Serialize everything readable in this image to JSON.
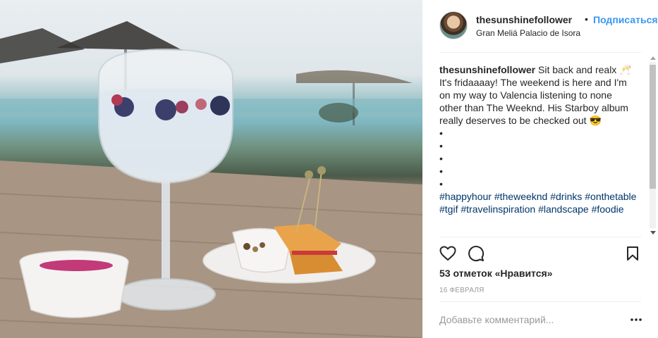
{
  "post": {
    "username": "thesunshinefollower",
    "separator": "•",
    "follow_label": "Подписаться",
    "location": "Gran Meliá Palacio de Isora"
  },
  "caption": {
    "username": "thesunshinefollower",
    "text": "Sit back and realx 🥂 It's fridaaaay! The weekend is here and I'm on my way to Valencia listening to none other than The Weeknd. His Starboy album really deserves to be checked out 😎",
    "bullets": [
      "•",
      "•",
      "•",
      "•",
      "•"
    ],
    "hashtags": "#happyhour #theweeknd #drinks #onthetable #tgif #travelinspiration #landscape #foodie"
  },
  "actions": {
    "like_icon": "heart-icon",
    "comment_icon": "comment-bubble-icon",
    "save_icon": "bookmark-icon"
  },
  "likes_text": "53 отметок «Нравится»",
  "date_text": "16 ФЕВРАЛЯ",
  "comment": {
    "placeholder": "Добавьте комментарий...",
    "more_icon": "ellipsis-icon"
  },
  "colors": {
    "follow": "#3897f0",
    "hashtag": "#003569",
    "text": "#262626",
    "muted": "#999999"
  }
}
